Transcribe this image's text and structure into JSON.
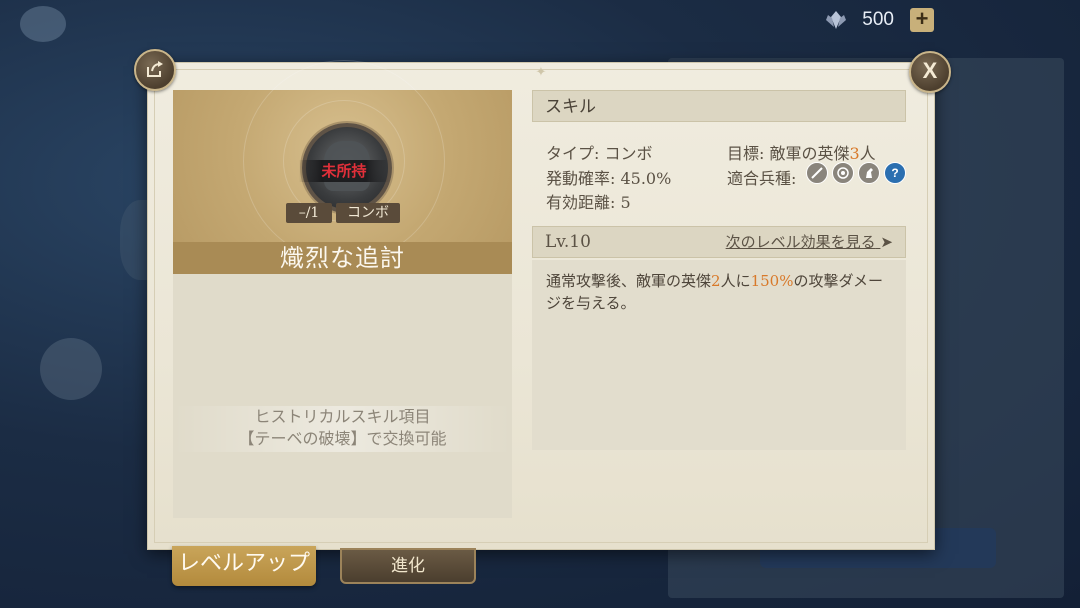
{
  "currency": {
    "icon": "crystal-icon",
    "value": "500",
    "add_icon": "plus-icon"
  },
  "dialog": {
    "share_icon": "share-icon",
    "close_label": "X"
  },
  "card": {
    "status": "未所持",
    "level_tag": "–/1",
    "type_tag": "コンボ",
    "name": "熾烈な追討",
    "history_line1": "ヒストリカルスキル項目",
    "history_line2": "【テーベの破壊】で交換可能"
  },
  "skill": {
    "header": "スキル",
    "type": "タイプ: コンボ",
    "rate": "発動確率: 45.0%",
    "range": "有効距離: 5",
    "target_prefix": "目標: 敵軍の英傑",
    "target_count": "3",
    "target_suffix": "人",
    "unit_label": "適合兵種:",
    "unit_icons": [
      "sword-icon",
      "bow-icon",
      "horse-icon",
      "question-icon"
    ]
  },
  "level": {
    "label": "Lv.10",
    "next_label": "次のレベル効果を見る",
    "next_icon": "arrow-right-icon"
  },
  "description": {
    "p1": "通常攻撃後、敵軍の英傑",
    "n1": "2",
    "p2": "人に",
    "n2": "150%",
    "p3": "の攻撃ダメージを与える。"
  },
  "buttons": {
    "level_up": "レベルアップ",
    "evolve": "進化"
  },
  "colors": {
    "highlight": "#d8792a",
    "unowned": "#e2303a",
    "gold": "#a98b55"
  }
}
